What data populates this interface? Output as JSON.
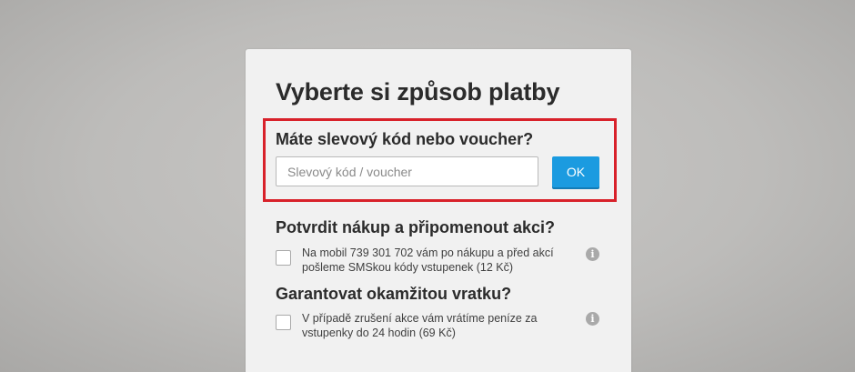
{
  "modal": {
    "title": "Vyberte si způsob platby"
  },
  "voucher": {
    "heading": "Máte slevový kód nebo voucher?",
    "placeholder": "Slevový kód / voucher",
    "value": "",
    "ok_label": "OK",
    "highlight_color": "#d8212a",
    "button_color": "#1b9be0"
  },
  "options": [
    {
      "heading": "Potvrdit nákup a připomenout akci?",
      "text": "Na mobil 739 301 702 vám po nákupu a před akcí pošleme SMSkou kódy vstupenek (12 Kč)",
      "checked": false,
      "info_icon": "info-icon",
      "info_glyph": "i"
    },
    {
      "heading": "Garantovat okamžitou vratku?",
      "text": "V případě zrušení akce vám vrátíme peníze za vstupenky do 24 hodin (69 Kč)",
      "checked": false,
      "info_icon": "info-icon",
      "info_glyph": "i"
    }
  ]
}
